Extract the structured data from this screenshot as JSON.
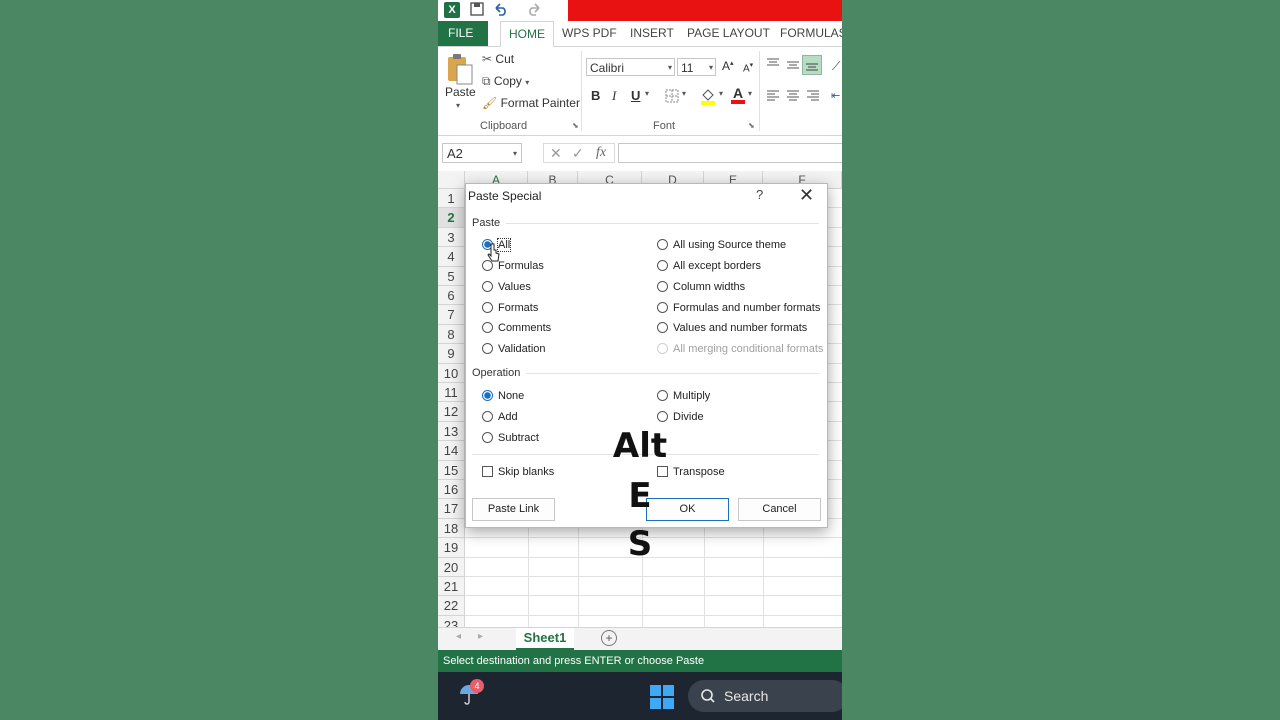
{
  "colors": {
    "excel_green": "#217346",
    "background": "#4a8762",
    "accent_red": "#e81212",
    "dialog_blue": "#1a6fc1"
  },
  "tabs": [
    "FILE",
    "HOME",
    "WPS PDF",
    "INSERT",
    "PAGE LAYOUT",
    "FORMULAS"
  ],
  "ribbon": {
    "paste_label": "Paste",
    "cut_label": "Cut",
    "copy_label": "Copy",
    "format_painter_label": "Format Painter",
    "clipboard_label": "Clipboard",
    "font_name": "Calibri",
    "font_size": "11",
    "font_label": "Font",
    "bold": "B",
    "italic": "I",
    "underline": "U"
  },
  "formula_bar": {
    "name_box": "A2",
    "fx": "fx",
    "formula": ""
  },
  "grid": {
    "columns": [
      "A",
      "B",
      "C",
      "D",
      "E",
      "F"
    ],
    "rows": [
      "1",
      "2",
      "3",
      "4",
      "5",
      "6",
      "7",
      "8",
      "9",
      "10",
      "11",
      "12",
      "13",
      "14",
      "15",
      "16",
      "17",
      "18",
      "19",
      "20",
      "21",
      "22",
      "23"
    ],
    "selected_row": "2"
  },
  "sheet_tabs": {
    "active": "Sheet1"
  },
  "status_bar": "Select destination and press ENTER or choose Paste",
  "taskbar": {
    "search": "Search",
    "badge": "4"
  },
  "dialog": {
    "title": "Paste Special",
    "help": "?",
    "paste_section": "Paste",
    "paste_left": [
      "All",
      "Formulas",
      "Values",
      "Formats",
      "Comments",
      "Validation"
    ],
    "paste_right": [
      "All using Source theme",
      "All except borders",
      "Column widths",
      "Formulas and number formats",
      "Values and number formats",
      "All merging conditional formats"
    ],
    "paste_selected": "All",
    "operation_section": "Operation",
    "operation_left": [
      "None",
      "Add",
      "Subtract"
    ],
    "operation_right": [
      "Multiply",
      "Divide"
    ],
    "operation_selected": "None",
    "skip_blanks": "Skip blanks",
    "transpose": "Transpose",
    "paste_link_button": "Paste Link",
    "ok_button": "OK",
    "cancel_button": "Cancel"
  },
  "overlay": {
    "line1": "Alt",
    "line2": "E",
    "line3": "S"
  }
}
